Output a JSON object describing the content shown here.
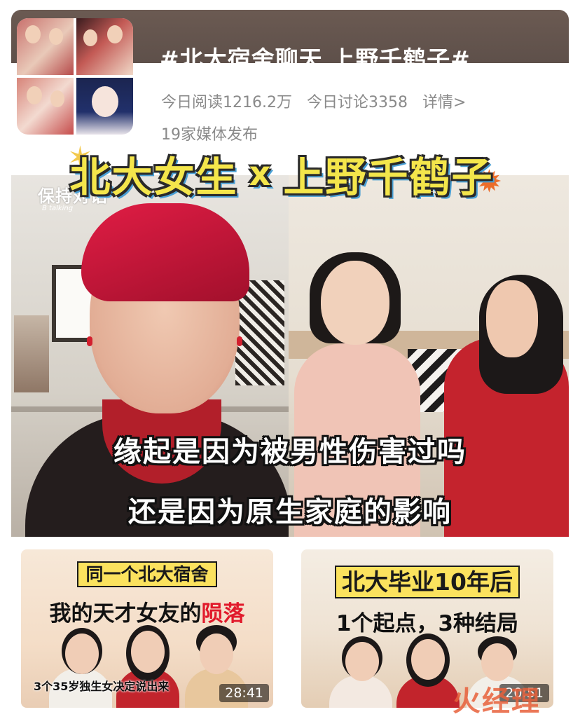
{
  "topic": {
    "title": "#北大宿舍聊天 上野千鹤子#",
    "reads": "今日阅读1216.2万",
    "discussions": "今日讨论3358",
    "details": "详情>",
    "media": "19家媒体发布"
  },
  "video": {
    "headline_left": "北大女生",
    "headline_x": "x",
    "headline_right": "上野千鹤子",
    "channel_logo": "保持对话",
    "channel_logo_sub": "B talking",
    "subtitle_1": "缘起是因为被男性伤害过吗",
    "subtitle_2": "还是因为原生家庭的影响"
  },
  "recommendations": [
    {
      "line1": "同一个北大宿舍",
      "line2_prefix": "我的天才女友的",
      "line2_highlight": "陨落",
      "footer": "3个35岁独生女决定说出来",
      "duration": "28:41"
    },
    {
      "line1": "北大毕业10年后",
      "line2": "1个起点，3种结局",
      "duration": "20:51"
    }
  ],
  "watermark": "火经理",
  "colors": {
    "headline_yellow": "#f4e64b",
    "highlight_red": "#e11a2b",
    "stats_gray": "#8a8a8a"
  }
}
